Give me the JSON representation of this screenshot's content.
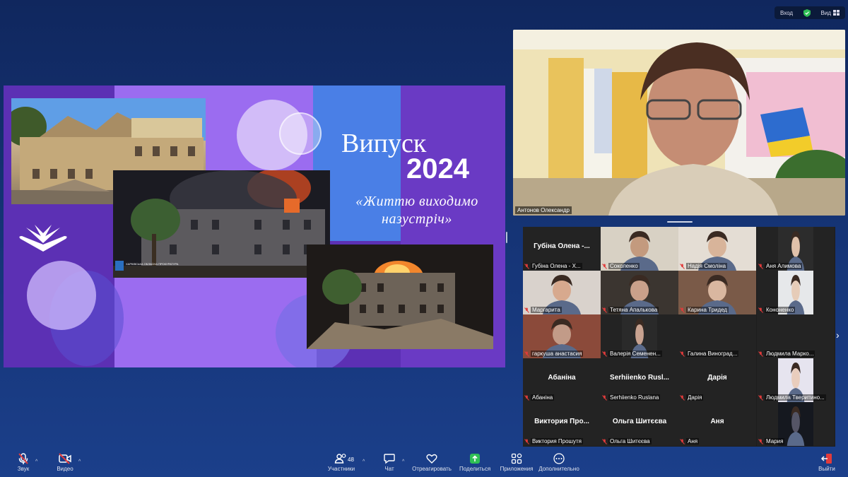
{
  "top_bar": {
    "enter_label": "Вход",
    "view_label": "Вид"
  },
  "slide": {
    "title_line1": "Випуск",
    "title_line2": "2024",
    "subtitle": "«Життю виходимо назустріч»",
    "photo_caption": "ХАРКІВСЬКА ОБЛАСНА ПРОКУРАТУРА"
  },
  "speaker": {
    "name": "Антонов Олександр"
  },
  "gallery": {
    "tiles": [
      {
        "big": "Губіна Олена -...",
        "label": "Губіна Олена - Х..."
      },
      {
        "big": "",
        "label": "Соколенко"
      },
      {
        "big": "",
        "label": "Надія Смоліна"
      },
      {
        "big": "",
        "label": "Аня Алимова"
      },
      {
        "big": "",
        "label": "Маргарита"
      },
      {
        "big": "",
        "label": "Тетяна Апалькова"
      },
      {
        "big": "",
        "label": "Карина Тридед"
      },
      {
        "big": "",
        "label": "Кононенко"
      },
      {
        "big": "",
        "label": "гаркуша анастасия"
      },
      {
        "big": "",
        "label": "Валерія Семенен..."
      },
      {
        "big": "",
        "label": "Галина Виноград..."
      },
      {
        "big": "",
        "label": "Людмила Марко..."
      },
      {
        "big": "Абаніна",
        "label": "Абаніна"
      },
      {
        "big": "Serhiienko Rusl...",
        "label": "Serhiienko Ruslana"
      },
      {
        "big": "Дарія",
        "label": "Дарія"
      },
      {
        "big": "",
        "label": "Людмила Тверитино..."
      },
      {
        "big": "Виктория Про...",
        "label": "Виктория Прошутя"
      },
      {
        "big": "Ольга Шитєєва",
        "label": "Ольга Шитєєва"
      },
      {
        "big": "Аня",
        "label": "Аня"
      },
      {
        "big": "",
        "label": "Мария"
      }
    ]
  },
  "toolbar": {
    "audio": "Звук",
    "video": "Видео",
    "participants": "Участники",
    "participants_count": "48",
    "chat": "Чат",
    "react": "Отреагировать",
    "share": "Поделиться",
    "apps": "Приложения",
    "more": "Дополнительно",
    "leave": "Выйти"
  },
  "colors": {
    "background": "#143272",
    "share_green": "#2fbf55",
    "muted_red": "#e23b3b"
  }
}
